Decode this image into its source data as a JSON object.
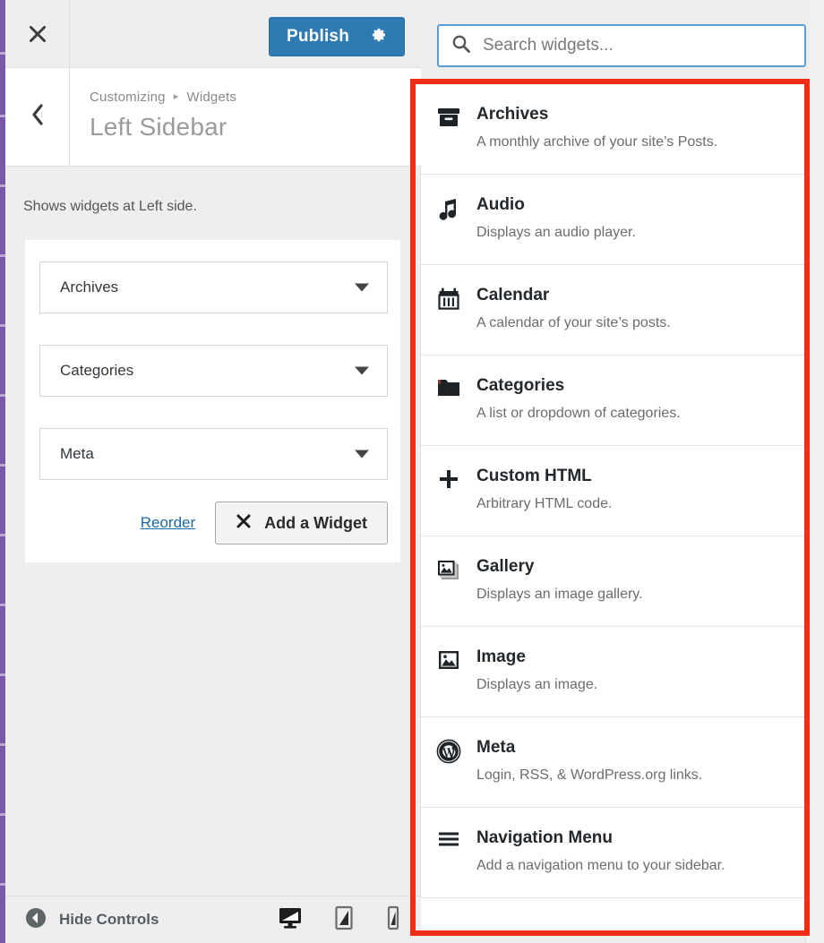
{
  "theme": {
    "accent_blue": "#2e7ab3",
    "highlight_red": "#f02e18",
    "focus_blue": "#5b9dd9",
    "admin_bar_purple": "#7a5aa8",
    "panel_bg": "#eeeeee",
    "text_dark": "#23282d",
    "text_muted": "#6c6c6c",
    "link_blue": "#1c6aa8"
  },
  "customizer": {
    "close_icon": "close-icon",
    "publish": {
      "label": "Publish",
      "gear_icon": "gear-icon"
    },
    "back_icon": "chevron-left-icon",
    "breadcrumb": {
      "root": "Customizing",
      "separator": "▸",
      "current": "Widgets"
    },
    "panel_title": "Left Sidebar",
    "section_description": "Shows widgets at Left side.",
    "assigned_widgets": [
      {
        "label": "Archives",
        "toggle_icon": "chevron-down-icon"
      },
      {
        "label": "Categories",
        "toggle_icon": "chevron-down-icon"
      },
      {
        "label": "Meta",
        "toggle_icon": "chevron-down-icon"
      }
    ],
    "reorder_label": "Reorder",
    "add_widget": {
      "label": "Add a Widget",
      "icon": "close-x-icon"
    },
    "footer": {
      "hide_controls_label": "Hide Controls",
      "collapse_icon": "collapse-left-icon",
      "devices": [
        {
          "name": "desktop-preview",
          "icon": "desktop-icon"
        },
        {
          "name": "tablet-preview",
          "icon": "tablet-icon"
        },
        {
          "name": "mobile-preview",
          "icon": "mobile-icon"
        }
      ]
    }
  },
  "available_widgets": {
    "search": {
      "placeholder": "Search widgets...",
      "value": "",
      "icon": "search-icon"
    },
    "items": [
      {
        "name": "Archives",
        "description": "A monthly archive of your site’s Posts.",
        "icon": "archive-box-icon"
      },
      {
        "name": "Audio",
        "description": "Displays an audio player.",
        "icon": "music-note-icon"
      },
      {
        "name": "Calendar",
        "description": "A calendar of your site’s posts.",
        "icon": "calendar-icon"
      },
      {
        "name": "Categories",
        "description": "A list or dropdown of categories.",
        "icon": "folder-icon"
      },
      {
        "name": "Custom HTML",
        "description": "Arbitrary HTML code.",
        "icon": "plus-icon"
      },
      {
        "name": "Gallery",
        "description": "Displays an image gallery.",
        "icon": "gallery-icon"
      },
      {
        "name": "Image",
        "description": "Displays an image.",
        "icon": "image-icon"
      },
      {
        "name": "Meta",
        "description": "Login, RSS, & WordPress.org links.",
        "icon": "wordpress-logo-icon"
      },
      {
        "name": "Navigation Menu",
        "description": "Add a navigation menu to your sidebar.",
        "icon": "hamburger-menu-icon"
      }
    ],
    "scrollbar": {
      "up_icon": "scroll-up-arrow-icon",
      "down_icon": "scroll-down-arrow-icon"
    }
  }
}
